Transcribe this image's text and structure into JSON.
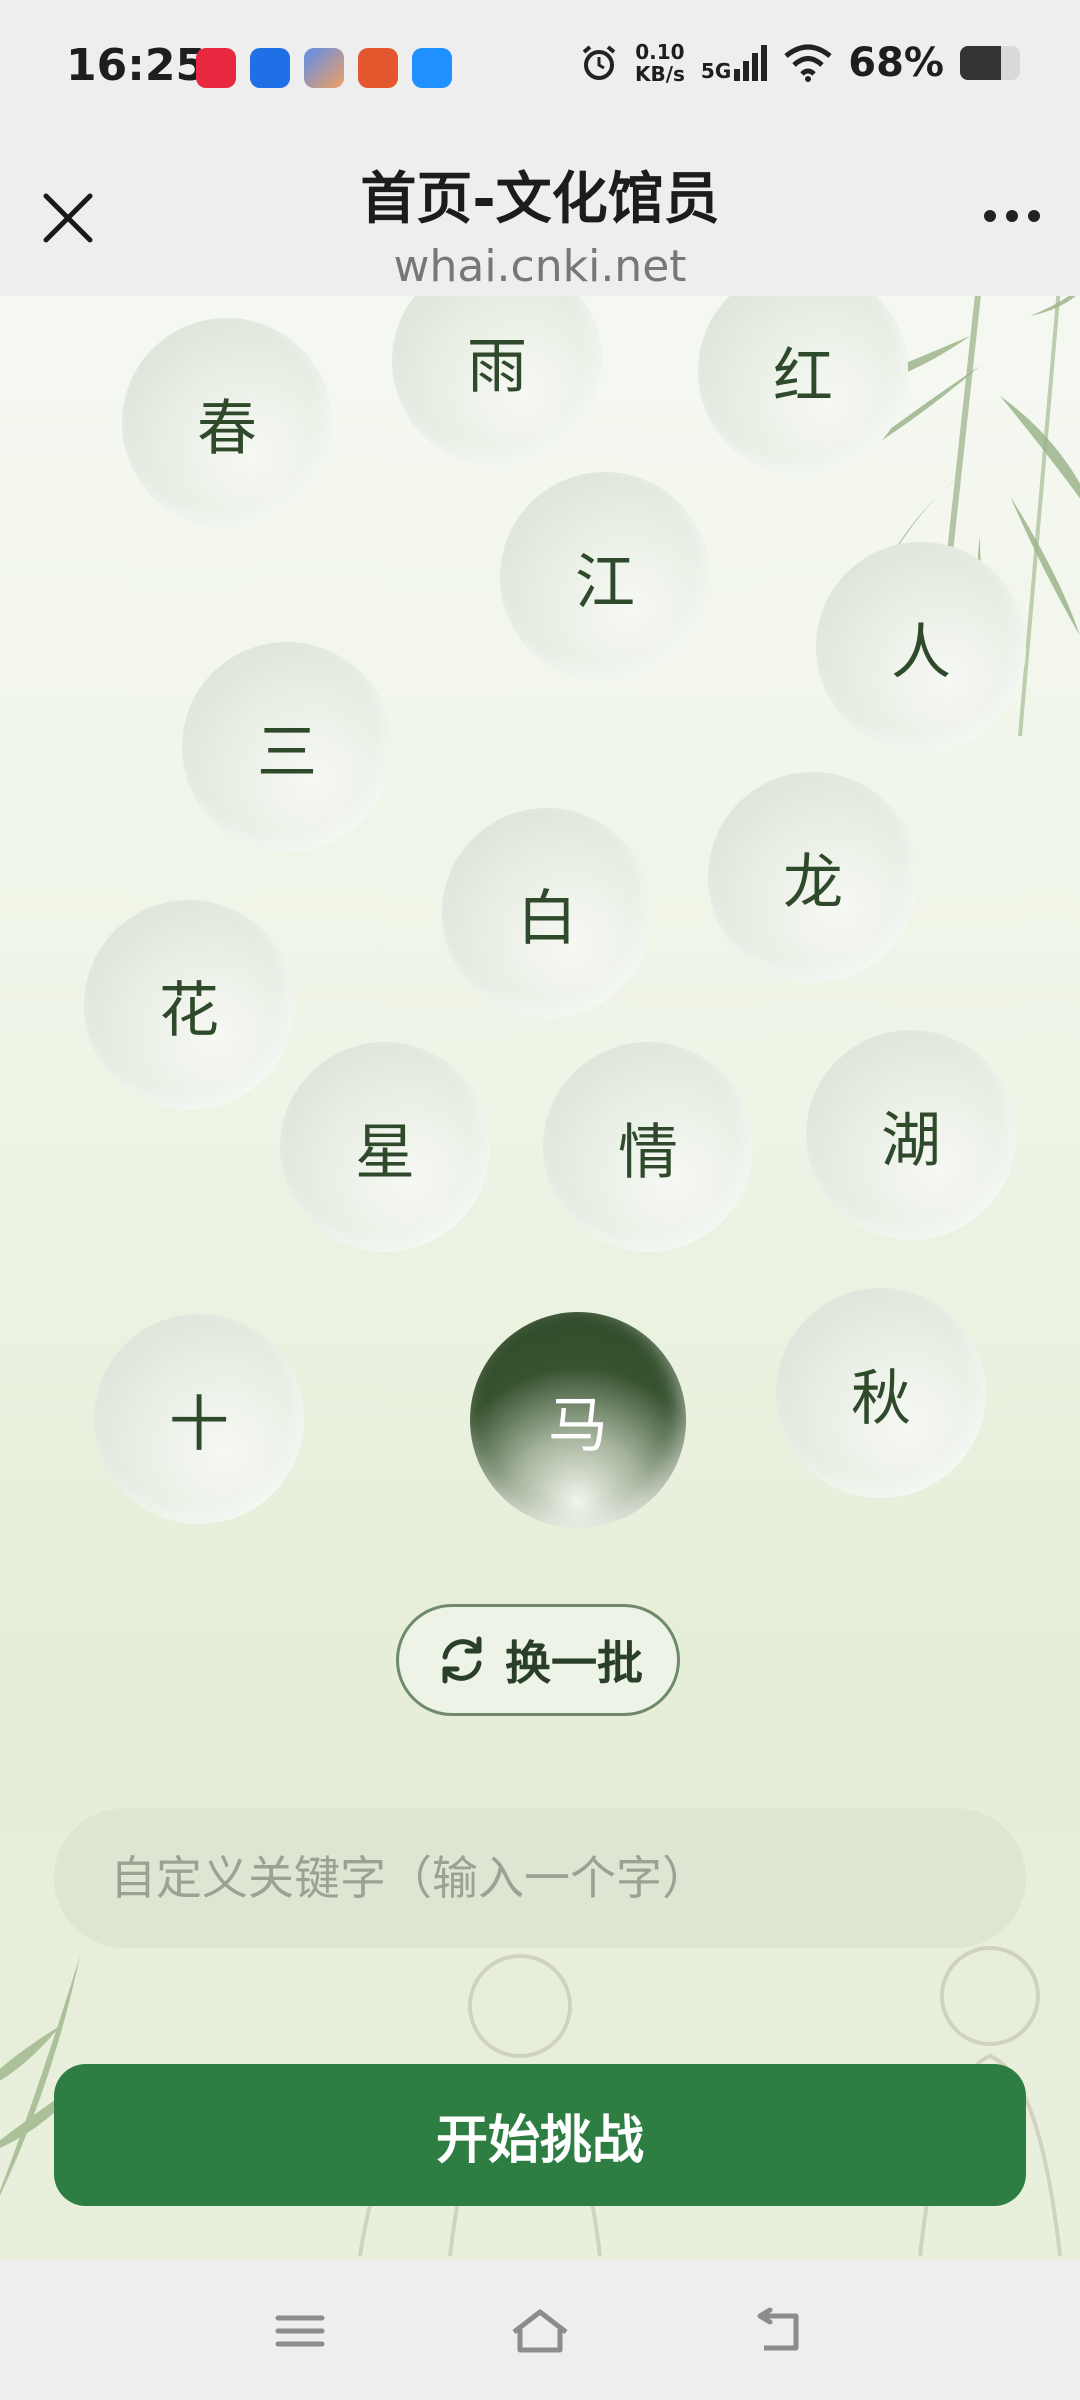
{
  "status_bar": {
    "time": "16:25",
    "net_speed_value": "0.10",
    "net_speed_unit": "KB/s",
    "network": "5G",
    "battery": "68%",
    "battery_level": 0.68,
    "app_icon_colors": [
      "#e8283e",
      "#1f6fe6",
      "#5b8ef0",
      "#e4572e",
      "#1e90ff"
    ]
  },
  "header": {
    "title": "首页-文化馆员",
    "domain": "whai.cnki.net",
    "close_icon": "close-icon",
    "more_icon": "more-icon"
  },
  "characters": [
    {
      "char": "春",
      "selected": false
    },
    {
      "char": "雨",
      "selected": false
    },
    {
      "char": "红",
      "selected": false
    },
    {
      "char": "江",
      "selected": false
    },
    {
      "char": "人",
      "selected": false
    },
    {
      "char": "三",
      "selected": false
    },
    {
      "char": "龙",
      "selected": false
    },
    {
      "char": "白",
      "selected": false
    },
    {
      "char": "花",
      "selected": false
    },
    {
      "char": "星",
      "selected": false
    },
    {
      "char": "情",
      "selected": false
    },
    {
      "char": "湖",
      "selected": false
    },
    {
      "char": "十",
      "selected": false
    },
    {
      "char": "马",
      "selected": true
    },
    {
      "char": "秋",
      "selected": false
    }
  ],
  "refresh": {
    "label": "换一批",
    "icon": "refresh-icon"
  },
  "custom_keyword": {
    "placeholder": "自定义关键字（输入一个字）",
    "value": ""
  },
  "start_button": {
    "label": "开始挑战"
  },
  "nav_bar": {
    "icons": [
      "menu-icon",
      "home-icon",
      "back-icon"
    ]
  },
  "colors": {
    "accent_green": "#2e7d43",
    "selected_bubble": "#37522f",
    "text_dark_green": "#2f4a2b"
  }
}
